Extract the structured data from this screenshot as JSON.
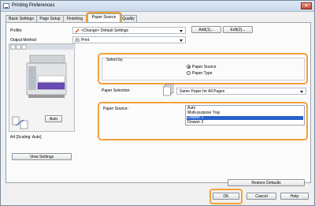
{
  "window": {
    "title": "Printing Preferences",
    "close_glyph": "✕"
  },
  "tabs": [
    {
      "label": "Basic Settings"
    },
    {
      "label": "Page Setup"
    },
    {
      "label": "Finishing"
    },
    {
      "label": "Paper Source",
      "active": true
    },
    {
      "label": "Quality"
    }
  ],
  "profile": {
    "label": "Profile:",
    "value": "<Change> Default Settings",
    "add_label": "Add(1)...",
    "edit_label": "Edit(2)..."
  },
  "output": {
    "label": "Output Method",
    "value": "Print"
  },
  "preview": {
    "auto_label": "Auto",
    "caption": "A4 [Scaling: Auto]",
    "view_settings_label": "View Settings"
  },
  "select_by": {
    "label": "Select by",
    "options": [
      "Paper Source",
      "Paper Type"
    ],
    "selected": "Paper Source"
  },
  "paper_selection": {
    "label": "Paper Selection:",
    "value": "Same Paper for All Pages"
  },
  "paper_source": {
    "label": "Paper Source:",
    "items": [
      "Auto",
      "Multi-purpose Tray",
      "Drawer 1",
      "Drawer 2"
    ],
    "selected": "Drawer 1"
  },
  "buttons": {
    "restore_defaults": "Restore Defaults",
    "ok": "OK",
    "cancel": "Cancel",
    "help": "Help"
  },
  "colors": {
    "highlight": "#f3a23a",
    "selection": "#2a62c9"
  }
}
